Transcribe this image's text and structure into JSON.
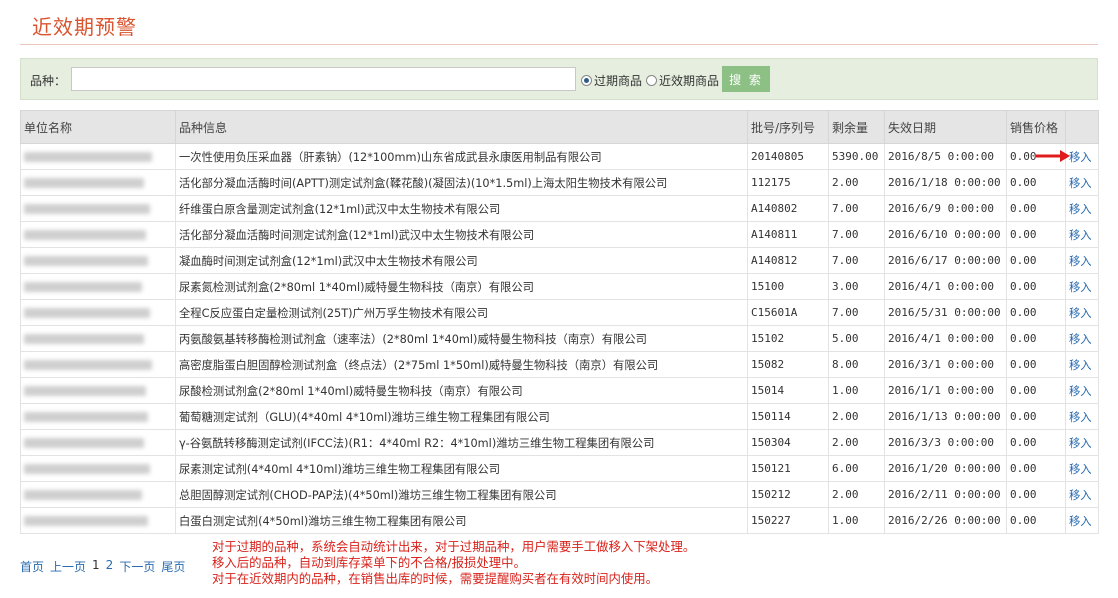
{
  "page": {
    "title": "近效期预警"
  },
  "search": {
    "label": "品种：",
    "value": "",
    "placeholder": "",
    "radio_expired": "过期商品",
    "radio_near": "近效期商品",
    "button": "搜 索",
    "selected": "过期商品"
  },
  "table": {
    "headers": [
      "单位名称",
      "品种信息",
      "批号/序列号",
      "剩余量",
      "失效日期",
      "销售价格",
      ""
    ],
    "rows": [
      {
        "product": "一次性使用负压采血器（肝素钠）(12*100mm)山东省成武县永康医用制品有限公司",
        "batch": "20140805",
        "qty": "5390.00",
        "expiry": "2016/8/5 0:00:00",
        "price": "0.00",
        "action": "移入"
      },
      {
        "product": "活化部分凝血活酶时间(APTT)测定试剂盒(鞣花酸)(凝固法)(10*1.5ml)上海太阳生物技术有限公司",
        "batch": "112175",
        "qty": "2.00",
        "expiry": "2016/1/18 0:00:00",
        "price": "0.00",
        "action": "移入"
      },
      {
        "product": "纤维蛋白原含量测定试剂盒(12*1ml)武汉中太生物技术有限公司",
        "batch": "A140802",
        "qty": "7.00",
        "expiry": "2016/6/9 0:00:00",
        "price": "0.00",
        "action": "移入"
      },
      {
        "product": "活化部分凝血活酶时间测定试剂盒(12*1ml)武汉中太生物技术有限公司",
        "batch": "A140811",
        "qty": "7.00",
        "expiry": "2016/6/10 0:00:00",
        "price": "0.00",
        "action": "移入"
      },
      {
        "product": "凝血酶时间测定试剂盒(12*1ml)武汉中太生物技术有限公司",
        "batch": "A140812",
        "qty": "7.00",
        "expiry": "2016/6/17 0:00:00",
        "price": "0.00",
        "action": "移入"
      },
      {
        "product": "尿素氮检测试剂盒(2*80ml 1*40ml)威特曼生物科技（南京）有限公司",
        "batch": "15100",
        "qty": "3.00",
        "expiry": "2016/4/1 0:00:00",
        "price": "0.00",
        "action": "移入"
      },
      {
        "product": "全程C反应蛋白定量检测试剂(25T)广州万孚生物技术有限公司",
        "batch": "C15601A",
        "qty": "7.00",
        "expiry": "2016/5/31 0:00:00",
        "price": "0.00",
        "action": "移入"
      },
      {
        "product": "丙氨酸氨基转移酶检测试剂盒（速率法）(2*80ml 1*40ml)威特曼生物科技（南京）有限公司",
        "batch": "15102",
        "qty": "5.00",
        "expiry": "2016/4/1 0:00:00",
        "price": "0.00",
        "action": "移入"
      },
      {
        "product": "高密度脂蛋白胆固醇检测试剂盒（终点法）(2*75ml 1*50ml)威特曼生物科技（南京）有限公司",
        "batch": "15082",
        "qty": "8.00",
        "expiry": "2016/3/1 0:00:00",
        "price": "0.00",
        "action": "移入"
      },
      {
        "product": "尿酸检测试剂盒(2*80ml 1*40ml)威特曼生物科技（南京）有限公司",
        "batch": "15014",
        "qty": "1.00",
        "expiry": "2016/1/1 0:00:00",
        "price": "0.00",
        "action": "移入"
      },
      {
        "product": "葡萄糖测定试剂（GLU)(4*40ml 4*10ml)潍坊三维生物工程集团有限公司",
        "batch": "150114",
        "qty": "2.00",
        "expiry": "2016/1/13 0:00:00",
        "price": "0.00",
        "action": "移入"
      },
      {
        "product": "γ-谷氨酰转移酶测定试剂(IFCC法)(R1：4*40ml R2：4*10ml)潍坊三维生物工程集团有限公司",
        "batch": "150304",
        "qty": "2.00",
        "expiry": "2016/3/3 0:00:00",
        "price": "0.00",
        "action": "移入"
      },
      {
        "product": "尿素测定试剂(4*40ml 4*10ml)潍坊三维生物工程集团有限公司",
        "batch": "150121",
        "qty": "6.00",
        "expiry": "2016/1/20 0:00:00",
        "price": "0.00",
        "action": "移入"
      },
      {
        "product": "总胆固醇测定试剂(CHOD-PAP法)(4*50ml)潍坊三维生物工程集团有限公司",
        "batch": "150212",
        "qty": "2.00",
        "expiry": "2016/2/11 0:00:00",
        "price": "0.00",
        "action": "移入"
      },
      {
        "product": "白蛋白测定试剂(4*50ml)潍坊三维生物工程集团有限公司",
        "batch": "150227",
        "qty": "1.00",
        "expiry": "2016/2/26 0:00:00",
        "price": "0.00",
        "action": "移入"
      }
    ]
  },
  "pager": {
    "first": "首页",
    "prev": "上一页",
    "page1": "1",
    "page2": "2",
    "next": "下一页",
    "last": "尾页"
  },
  "notes": [
    "对于过期的品种，系统会自动统计出来，对于过期品种，用户需要手工做移入下架处理。",
    "移入后的品种，自动到库存菜单下的不合格/报损处理中。",
    "对于在近效期内的品种，在销售出库的时候，需要提醒购买者在有效时间内使用。"
  ]
}
